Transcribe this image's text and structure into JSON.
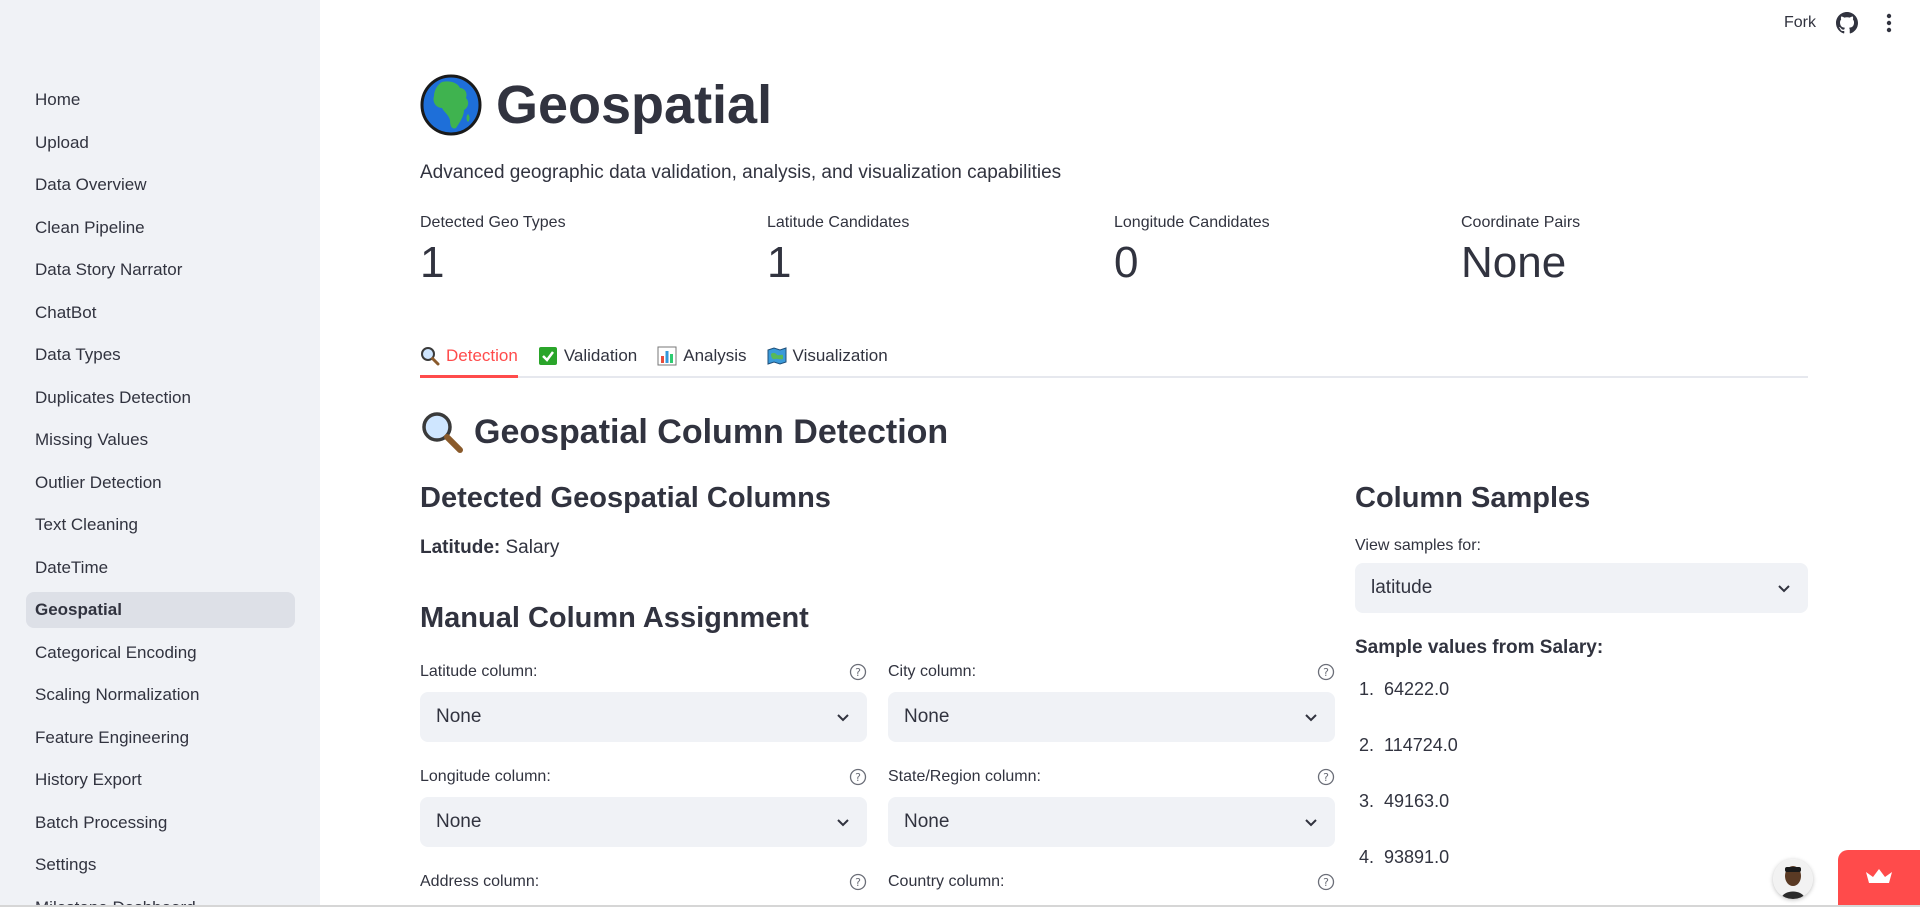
{
  "sidebar": {
    "items": [
      {
        "label": "Home"
      },
      {
        "label": "Upload"
      },
      {
        "label": "Data Overview"
      },
      {
        "label": "Clean Pipeline"
      },
      {
        "label": "Data Story Narrator"
      },
      {
        "label": "ChatBot"
      },
      {
        "label": "Data Types"
      },
      {
        "label": "Duplicates Detection"
      },
      {
        "label": "Missing Values"
      },
      {
        "label": "Outlier Detection"
      },
      {
        "label": "Text Cleaning"
      },
      {
        "label": "DateTime"
      },
      {
        "label": "Geospatial",
        "active": true
      },
      {
        "label": "Categorical Encoding"
      },
      {
        "label": "Scaling Normalization"
      },
      {
        "label": "Feature Engineering"
      },
      {
        "label": "History Export"
      },
      {
        "label": "Batch Processing"
      },
      {
        "label": "Settings"
      },
      {
        "label": "Milestone Dashboard"
      }
    ]
  },
  "topbar": {
    "fork_label": "Fork",
    "github_icon": "github-icon",
    "menu_icon": "kebab-menu-icon"
  },
  "page": {
    "title": "Geospatial",
    "title_icon": "globe-africa-icon",
    "subtitle": "Advanced geographic data validation, analysis, and visualization capabilities"
  },
  "metrics": [
    {
      "label": "Detected Geo Types",
      "value": "1"
    },
    {
      "label": "Latitude Candidates",
      "value": "1"
    },
    {
      "label": "Longitude Candidates",
      "value": "0"
    },
    {
      "label": "Coordinate Pairs",
      "value": "None"
    }
  ],
  "tabs": [
    {
      "label": "Detection",
      "icon": "magnifier-icon",
      "active": true
    },
    {
      "label": "Validation",
      "icon": "check-box-icon"
    },
    {
      "label": "Analysis",
      "icon": "bar-chart-icon"
    },
    {
      "label": "Visualization",
      "icon": "map-icon"
    }
  ],
  "detection": {
    "heading": "Geospatial Column Detection",
    "detected_heading": "Detected Geospatial Columns",
    "latitude_label": "Latitude:",
    "latitude_value": "Salary",
    "manual_heading": "Manual Column Assignment",
    "fields": [
      {
        "label": "Latitude column:",
        "value": "None"
      },
      {
        "label": "City column:",
        "value": "None"
      },
      {
        "label": "Longitude column:",
        "value": "None"
      },
      {
        "label": "State/Region column:",
        "value": "None"
      },
      {
        "label": "Address column:",
        "value": ""
      },
      {
        "label": "Country column:",
        "value": ""
      }
    ]
  },
  "samples": {
    "heading": "Column Samples",
    "view_label": "View samples for:",
    "selected": "latitude",
    "sample_title": "Sample values from Salary:",
    "values": [
      {
        "n": "1.",
        "v": "64222.0"
      },
      {
        "n": "2.",
        "v": "114724.0"
      },
      {
        "n": "3.",
        "v": "49163.0"
      },
      {
        "n": "4.",
        "v": "93891.0"
      }
    ]
  },
  "colors": {
    "accent": "#ff4b4b",
    "sidebar_bg": "#f0f2f6",
    "text": "#31333f"
  }
}
